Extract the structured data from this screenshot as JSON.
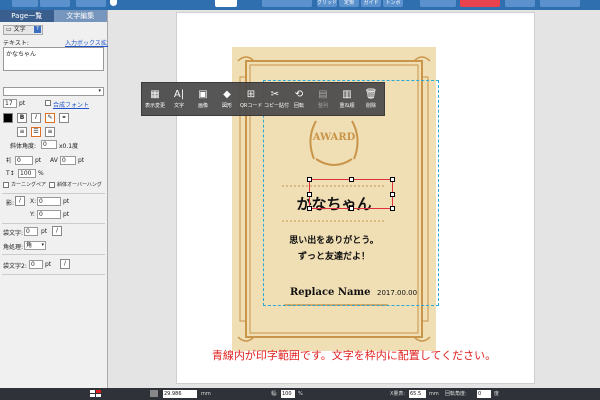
{
  "top": {
    "buttons": [
      "グリッド",
      "定規",
      "ガイド",
      "トンボ"
    ]
  },
  "left": {
    "tabs": [
      "Page一覧",
      "文字編集"
    ],
    "section": "文字",
    "text_label": "テキスト:",
    "expand_link": "入力ボックス拡大",
    "text_value": "かなちゃん",
    "font_size": "17",
    "font_unit": "pt",
    "synth_font": "合成フォント",
    "bold": "B",
    "italic": "I",
    "rotation_label": "斜体角度:",
    "rotation_value": "0",
    "rotation_unit": "x0.1度",
    "tracking_value": "0",
    "tracking_unit": "pt",
    "av_label": "AV",
    "av_value": "0",
    "av_unit": "pt",
    "scale_value": "100",
    "scale_unit": "%",
    "kerning_pair": "カーニングペア",
    "italic_overhang": "斜体オーバーハング",
    "shadow_label": "影:",
    "shadow_x_label": "X:",
    "shadow_x": "0",
    "shadow_y_label": "Y:",
    "shadow_y": "0",
    "shadow_unit": "pt",
    "outline_label": "袋文字:",
    "outline_value": "0",
    "outline_unit": "pt",
    "corner_label": "角処理:",
    "corner_value": "角",
    "outline2_label": "袋文字2:",
    "outline2_value": "0",
    "outline2_unit": "pt"
  },
  "toolbar": [
    {
      "icon": "▦",
      "label": "表示変更"
    },
    {
      "icon": "A|",
      "label": "文字"
    },
    {
      "icon": "▣",
      "label": "画像"
    },
    {
      "icon": "◆",
      "label": "図形"
    },
    {
      "icon": "⊞",
      "label": "QRコード"
    },
    {
      "icon": "✂",
      "label": "コピー貼付"
    },
    {
      "icon": "⟲",
      "label": "回転"
    },
    {
      "icon": "▤",
      "label": "整列"
    },
    {
      "icon": "▥",
      "label": "重ね順"
    },
    {
      "icon": "🗑",
      "label": "削除"
    }
  ],
  "cert": {
    "award": "AWARD",
    "name": "かなちゃん",
    "message1": "思い出をありがとう。",
    "message2": "ずっと友達だよ！",
    "replace_name": "Replace Name",
    "date": "2017.00.00"
  },
  "notice": "青線内が印字範囲です。文字を枠内に配置してください。",
  "bottom": {
    "x_value": "29.986",
    "x_unit": "mm",
    "w_label": "幅:",
    "w_value": "100",
    "w_unit": "%",
    "xscale_label": "X量表:",
    "xscale_value": "65.5",
    "xscale_unit": "mm",
    "rot_label": "回転角度:",
    "rot_value": "0",
    "rot_unit": "度"
  },
  "colors": {
    "frame": "#c9954a",
    "guide": "#2aa8d8",
    "notice": "#e02020",
    "selection": "#e03040"
  }
}
